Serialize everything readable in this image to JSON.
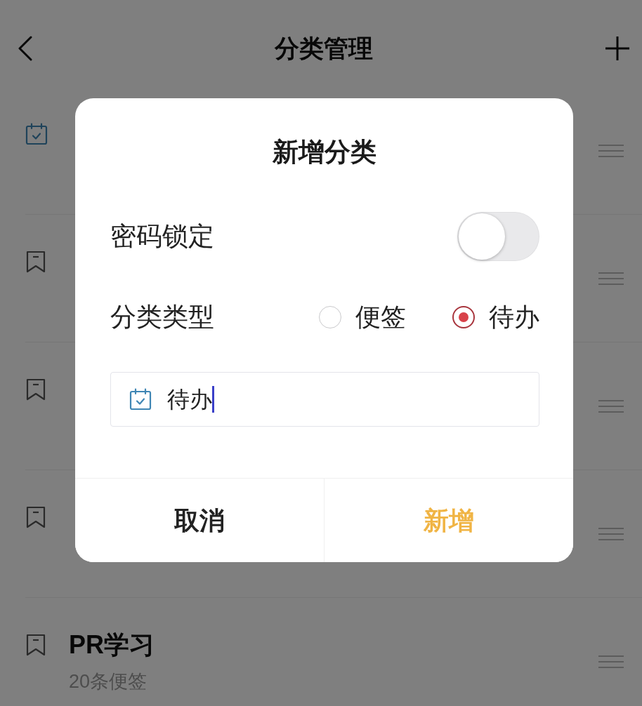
{
  "header": {
    "title": "分类管理"
  },
  "categories": [
    {
      "kind": "todo"
    },
    {
      "kind": "note"
    },
    {
      "kind": "note"
    },
    {
      "kind": "note"
    },
    {
      "kind": "note",
      "title": "PR学习",
      "subtitle": "20条便签"
    }
  ],
  "dialog": {
    "title": "新增分类",
    "password_lock": {
      "label": "密码锁定",
      "on": false
    },
    "category_type": {
      "label": "分类类型",
      "options": [
        {
          "label": "便签",
          "selected": false
        },
        {
          "label": "待办",
          "selected": true
        }
      ]
    },
    "name_field": {
      "kind": "todo",
      "value": "待办",
      "focused": true
    },
    "buttons": [
      {
        "kind": "cancel",
        "label": "取消"
      },
      {
        "kind": "confirm",
        "label": "新增"
      }
    ]
  }
}
